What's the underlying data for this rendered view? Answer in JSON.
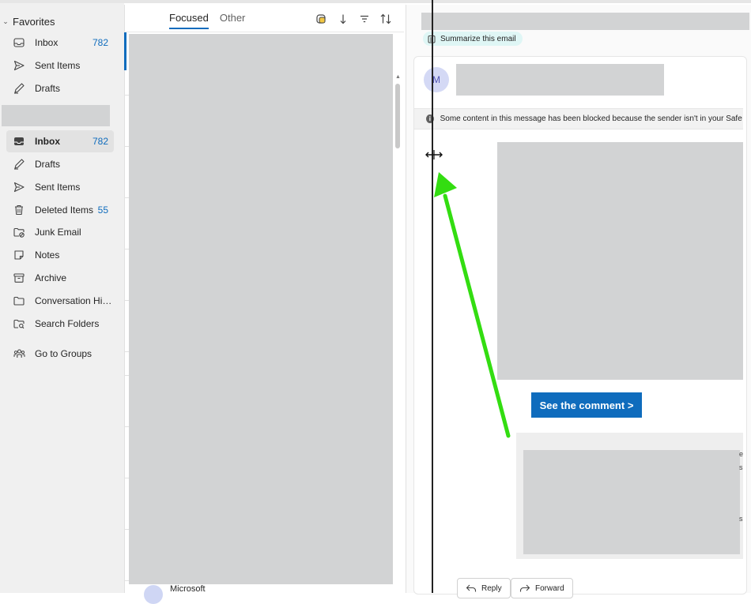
{
  "nav": {
    "favorites_title": "Favorites",
    "favorites": [
      {
        "label": "Inbox",
        "count": "782",
        "icon": "inbox-icon"
      },
      {
        "label": "Sent Items",
        "count": "",
        "icon": "send-icon"
      },
      {
        "label": "Drafts",
        "count": "",
        "icon": "pencil-icon"
      }
    ],
    "folders": [
      {
        "label": "Inbox",
        "count": "782",
        "icon": "inbox-icon",
        "selected": true
      },
      {
        "label": "Drafts",
        "count": "",
        "icon": "pencil-icon"
      },
      {
        "label": "Sent Items",
        "count": "",
        "icon": "send-icon"
      },
      {
        "label": "Deleted Items",
        "count": "55",
        "icon": "trash-icon"
      },
      {
        "label": "Junk Email",
        "count": "",
        "icon": "junk-folder-icon"
      },
      {
        "label": "Notes",
        "count": "",
        "icon": "note-icon"
      },
      {
        "label": "Archive",
        "count": "",
        "icon": "archive-icon"
      },
      {
        "label": "Conversation Hist...",
        "count": "",
        "icon": "folder-icon"
      },
      {
        "label": "Search Folders",
        "count": "",
        "icon": "search-folder-icon"
      }
    ],
    "groups_label": "Go to Groups"
  },
  "list": {
    "tab_focused": "Focused",
    "tab_other": "Other",
    "bottom_sender": "Microsoft"
  },
  "reading": {
    "summarize_label": "Summarize this email",
    "avatar_initial": "M",
    "blocked_notice": "Some content in this message has been blocked because the sender isn't in your Safe senders list.",
    "cta_label": "See the comment >",
    "reply_label": "Reply",
    "forward_label": "Forward"
  },
  "colors": {
    "accent": "#0f6cbd",
    "arrow": "#33dd11",
    "placeholder": "#d2d3d4"
  }
}
